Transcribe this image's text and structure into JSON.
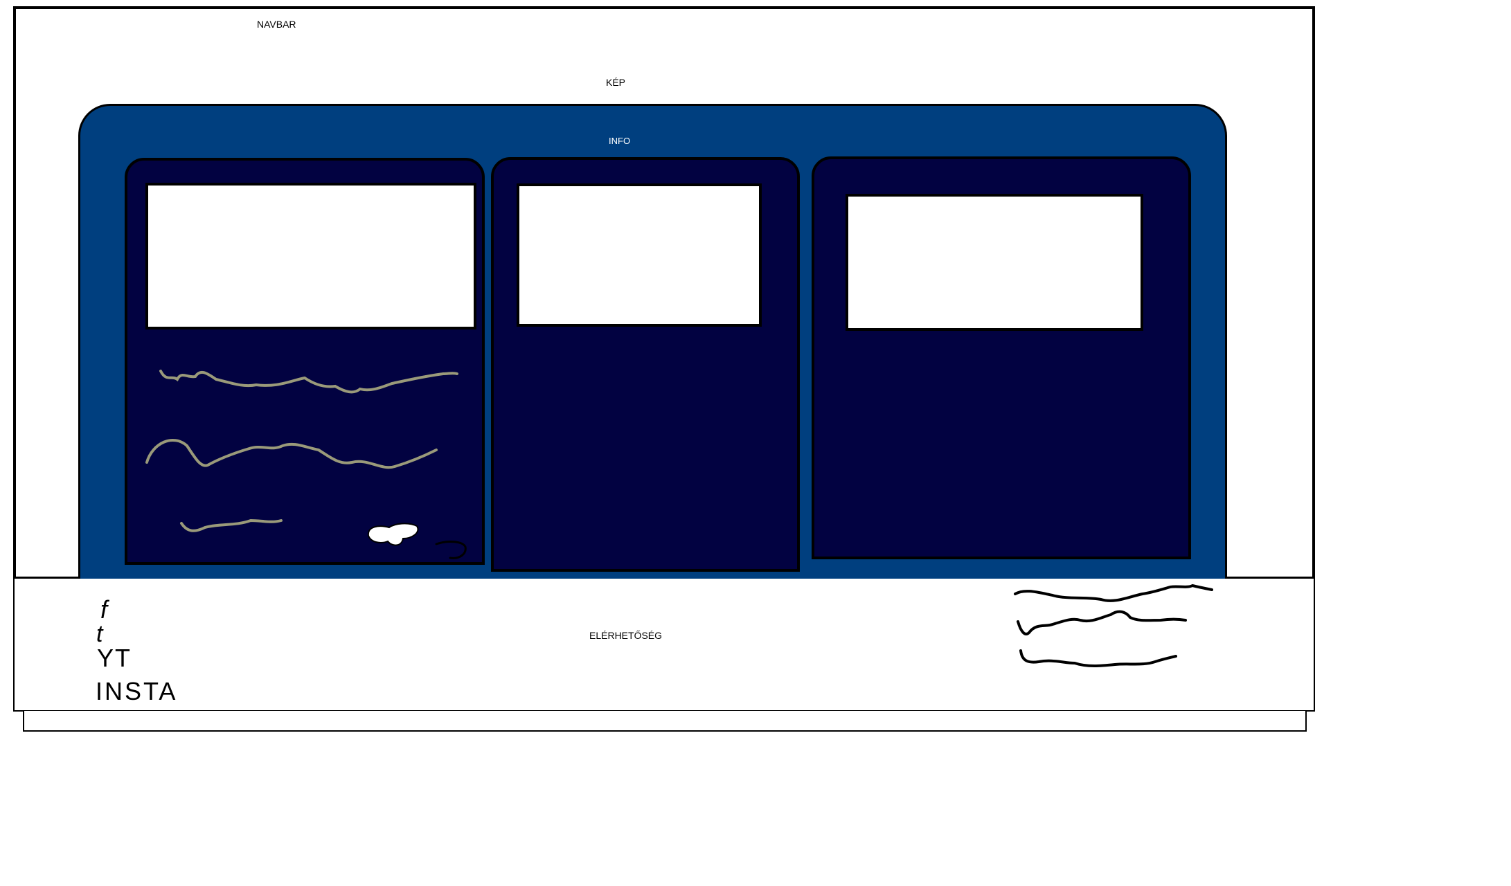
{
  "navbar": {
    "label": "NAVBAR"
  },
  "hero": {
    "label": "KÉP"
  },
  "info": {
    "label": "INFO"
  },
  "cards": [
    {
      "image": "",
      "has_text": true
    },
    {
      "image": ""
    },
    {
      "image": ""
    }
  ],
  "footer": {
    "label": "ELÉRHETŐSÉG",
    "social": [
      "f",
      "t",
      "YT",
      "INSTA"
    ]
  },
  "colors": {
    "panel": "#003f7f",
    "card": "#020241",
    "border": "#000000",
    "scribble_on_dark": "#9a9a7a"
  }
}
